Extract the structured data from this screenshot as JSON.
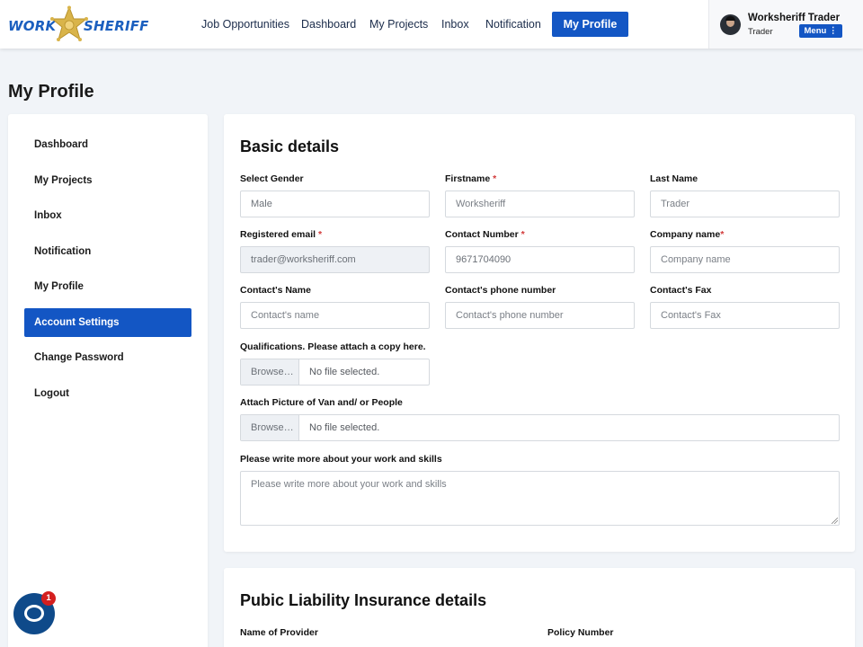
{
  "brand": {
    "word1": "WORK",
    "word2": "SHERIFF"
  },
  "nav": {
    "items": [
      "Job Opportunities",
      "Dashboard",
      "My Projects",
      "Inbox",
      "Notification"
    ],
    "active": "My Profile"
  },
  "user": {
    "name": "Worksheriff Trader",
    "role": "Trader",
    "menu_label": "Menu ⋮"
  },
  "page_title": "My Profile",
  "sidebar": {
    "items": [
      {
        "label": "Dashboard"
      },
      {
        "label": "My Projects"
      },
      {
        "label": "Inbox"
      },
      {
        "label": "Notification"
      },
      {
        "label": "My Profile"
      },
      {
        "label": "Account Settings",
        "active": true
      },
      {
        "label": "Change Password"
      },
      {
        "label": "Logout"
      }
    ]
  },
  "basic": {
    "title": "Basic details",
    "gender_label": "Select Gender",
    "gender_value": "Male",
    "firstname_label": "Firstname",
    "firstname_placeholder": "Worksheriff",
    "lastname_label": "Last Name",
    "lastname_placeholder": "Trader",
    "email_label": "Registered email",
    "email_value": "trader@worksheriff.com",
    "contact_number_label": "Contact Number",
    "contact_number_value": "9671704090",
    "company_label": "Company name",
    "company_placeholder": "Company name",
    "contact_name_label": "Contact's Name",
    "contact_name_placeholder": "Contact's name",
    "contact_phone_label": "Contact's phone number",
    "contact_phone_placeholder": "Contact's phone number",
    "contact_fax_label": "Contact's Fax",
    "contact_fax_placeholder": "Contact's Fax",
    "qualifications_label": "Qualifications. Please attach a copy here.",
    "picture_label": "Attach Picture of Van and/ or People",
    "browse_label": "Browse…",
    "no_file": "No file selected.",
    "about_label": "Please write more about your work and skills",
    "about_placeholder": "Please write more about your work and skills",
    "required_mark": "*"
  },
  "insurance": {
    "title": "Pubic Liability Insurance details",
    "provider_label": "Name of Provider",
    "policy_label": "Policy Number"
  },
  "chat": {
    "badge": "1"
  },
  "colors": {
    "primary": "#1356c4",
    "required": "#d23b3b",
    "page_bg": "#f1f4f8"
  }
}
